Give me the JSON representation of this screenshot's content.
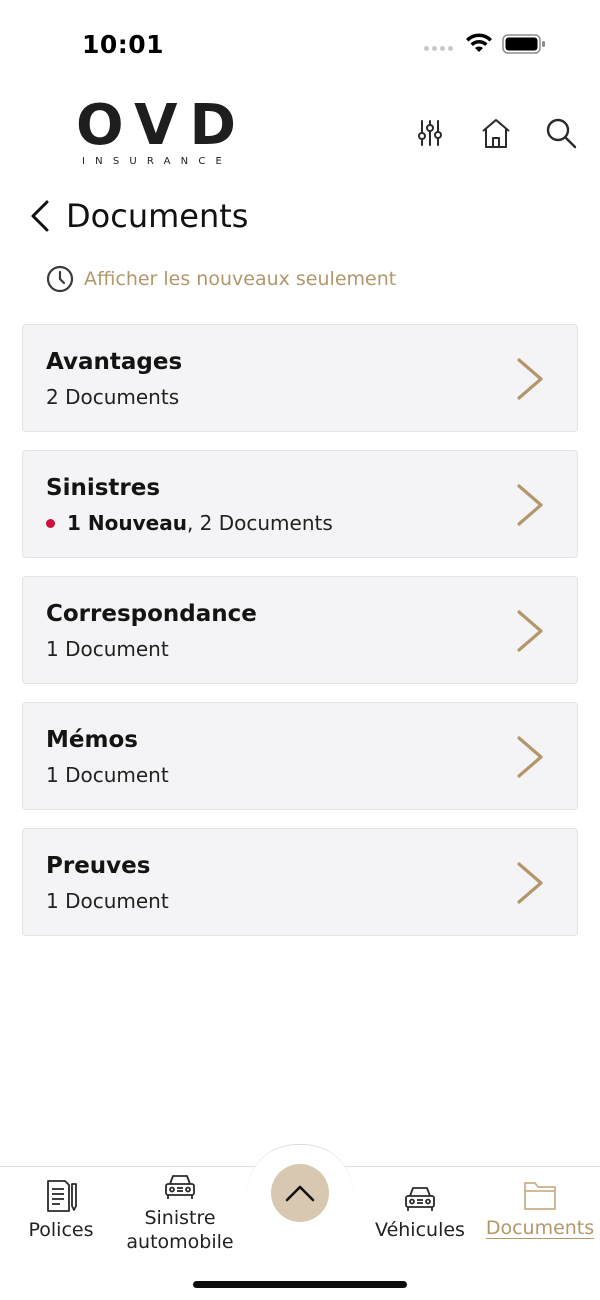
{
  "status_bar": {
    "time": "10:01"
  },
  "header": {
    "logo_text": "OVD",
    "logo_subtext": "INSURANCE",
    "icons": [
      "sliders-icon",
      "home-icon",
      "search-icon"
    ]
  },
  "page": {
    "title": "Documents",
    "filter_label": "Afficher les nouveaux seulement"
  },
  "folders": [
    {
      "name": "Avantages",
      "new_label": "",
      "count": "2 Documents"
    },
    {
      "name": "Sinistres",
      "new_label": "1 Nouveau",
      "count": ", 2 Documents"
    },
    {
      "name": "Correspondance",
      "new_label": "",
      "count": "1 Document"
    },
    {
      "name": "Mémos",
      "new_label": "",
      "count": "1 Document"
    },
    {
      "name": "Preuves",
      "new_label": "",
      "count": "1 Document"
    }
  ],
  "bottom_nav": {
    "items": [
      {
        "label": "Polices",
        "icon": "document-pen-icon"
      },
      {
        "label_line1": "Sinistre",
        "label_line2": "automobile",
        "icon": "car-icon"
      },
      {
        "label": "Véhicules",
        "icon": "car-icon"
      },
      {
        "label": "Documents",
        "icon": "folder-icon",
        "active": true
      }
    ],
    "fab_icon": "chevron-up-icon"
  },
  "colors": {
    "accent": "#b3976a",
    "new_dot": "#d10d3c",
    "card_bg": "#f4f4f6",
    "fab_bg": "#d8c8b1"
  }
}
